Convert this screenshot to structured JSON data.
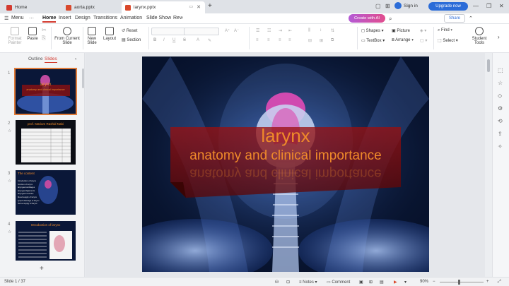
{
  "tabs": [
    {
      "label": "Home",
      "color": "#d33a2f"
    },
    {
      "label": "aorta.pptx",
      "color": "#d9492c"
    },
    {
      "label": "larynx.pptx",
      "color": "#d9492c"
    }
  ],
  "titlebar": {
    "signin": "Sign in",
    "upgrade": "Upgrade now"
  },
  "menubar": {
    "menu": "Menu",
    "items": [
      "Home",
      "Insert",
      "Design",
      "Transitions",
      "Animation",
      "Slide Show",
      "Rev"
    ],
    "create_ai": "Create with AI",
    "share": "Share"
  },
  "ribbon": {
    "format_painter": [
      "Format",
      "Painter"
    ],
    "paste": "Paste",
    "from_current_slide": [
      "From Current",
      "Slide"
    ],
    "new_slide": [
      "New",
      "Slide"
    ],
    "layout": "Layout",
    "reset": "Reset",
    "section": "Section",
    "shapes": "Shapes",
    "picture": "Picture",
    "textbox": "TextBox",
    "arrange": "Arrange",
    "find": "Find",
    "select": "Select",
    "student_tools": "Student Tools",
    "bold": "B",
    "italic": "I",
    "underline": "U",
    "strike": "S",
    "font_grow": "A⁺",
    "font_shrink": "A⁻"
  },
  "left_panel": {
    "outline": "Outline",
    "slides": "Slides",
    "thumbnails": [
      {
        "num": "1",
        "title": "larynx",
        "subtitle": "anatomy and clinical importance"
      },
      {
        "num": "2",
        "title": "prof. Marium Rashid Nabi"
      },
      {
        "num": "3",
        "title": "The content",
        "items": [
          "Introduction of larynx",
          "function of larynx",
          "laryngeal cartilages",
          "laryngeal ligaments",
          "laryngeal muscles",
          "blood supply of larynx",
          "lymph drainage of larynx",
          "Nerve supply of larynx"
        ]
      },
      {
        "num": "4",
        "title": "Introduction of larynx"
      }
    ]
  },
  "slide": {
    "title": "larynx",
    "subtitle": "anatomy and clinical importance",
    "accent": "#ef8a2a"
  },
  "status": {
    "slide_info": "Slide 1 / 37",
    "notes": "Notes",
    "comment": "Comment",
    "zoom": "90%"
  }
}
